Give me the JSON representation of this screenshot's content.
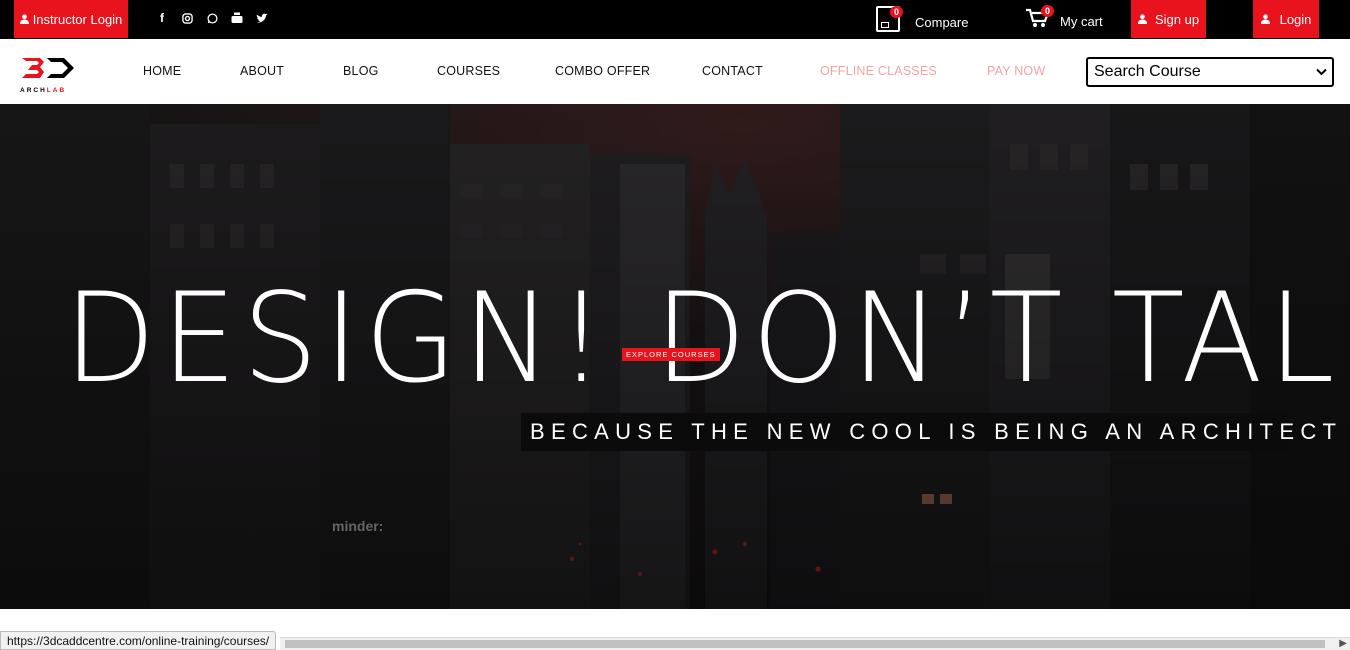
{
  "topbar": {
    "instructor_login": "Instructor Login",
    "social_icons": [
      "facebook-icon",
      "instagram-icon",
      "whatsapp-icon",
      "youtube-icon",
      "twitter-icon"
    ],
    "compare_label": "Compare",
    "compare_count": "0",
    "cart_label": "My cart",
    "cart_count": "0",
    "signup_label": "Sign up",
    "login_label": "Login"
  },
  "logo": {
    "mark": "3D",
    "sub": "ARCHLAB"
  },
  "nav": {
    "items": [
      "HOME",
      "ABOUT",
      "BLOG",
      "COURSES",
      "COMBO OFFER",
      "CONTACT",
      "OFFLINE CLASSES",
      "PAY NOW"
    ]
  },
  "search": {
    "selected": "Search Course"
  },
  "hero": {
    "headline": "DESIGN! DON’T TALK",
    "explore_label": "EXPLORE COURSES",
    "subline": "BECAUSE THE NEW COOL IS BEING AN ARCHITECT",
    "overlay_text": "minder:"
  },
  "statusbar": {
    "url": "https://3dcaddcentre.com/online-training/courses/"
  },
  "colors": {
    "accent": "#e8131d",
    "nav_pink": "#f2a3a8",
    "topbar_bg": "#000000"
  }
}
